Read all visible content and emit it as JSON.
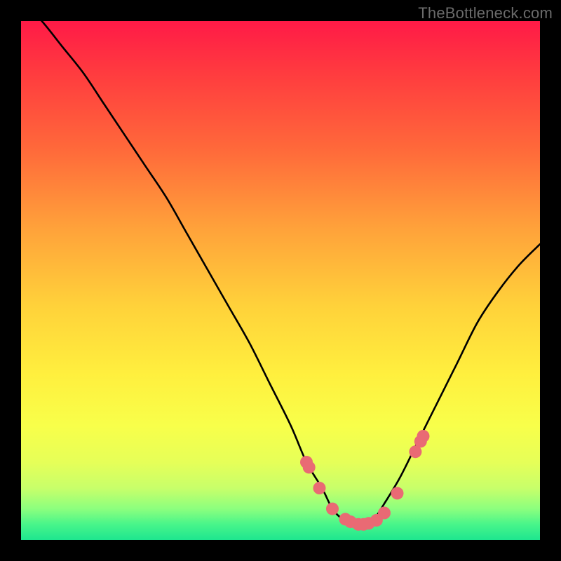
{
  "watermark": "TheBottleneck.com",
  "chart_data": {
    "type": "line",
    "title": "",
    "xlabel": "",
    "ylabel": "",
    "xlim": [
      0,
      100
    ],
    "ylim": [
      0,
      100
    ],
    "series": [
      {
        "name": "bottleneck-curve",
        "x": [
          0,
          4,
          8,
          12,
          16,
          20,
          24,
          28,
          32,
          36,
          40,
          44,
          48,
          52,
          55,
          58,
          60,
          62,
          64,
          66,
          68,
          70,
          73,
          76,
          80,
          84,
          88,
          92,
          96,
          100
        ],
        "values": [
          104,
          100,
          95,
          90,
          84,
          78,
          72,
          66,
          59,
          52,
          45,
          38,
          30,
          22,
          15,
          10,
          6,
          4,
          3,
          3,
          4,
          7,
          12,
          18,
          26,
          34,
          42,
          48,
          53,
          57
        ]
      }
    ],
    "markers": {
      "name": "highlight-dots",
      "color": "#e96a74",
      "radius": 9,
      "x": [
        55,
        55.5,
        57.5,
        60,
        62.5,
        63.5,
        65,
        66,
        67,
        68.5,
        70,
        72.5,
        76,
        77,
        77.5
      ],
      "values": [
        15,
        14,
        10,
        6,
        4,
        3.5,
        3,
        3,
        3.2,
        3.8,
        5.2,
        9,
        17,
        19,
        20
      ]
    }
  },
  "colors": {
    "curve": "#000000",
    "marker": "#e96a74",
    "background_top": "#ff1a47",
    "background_bottom": "#1ee68f",
    "frame": "#000000"
  }
}
